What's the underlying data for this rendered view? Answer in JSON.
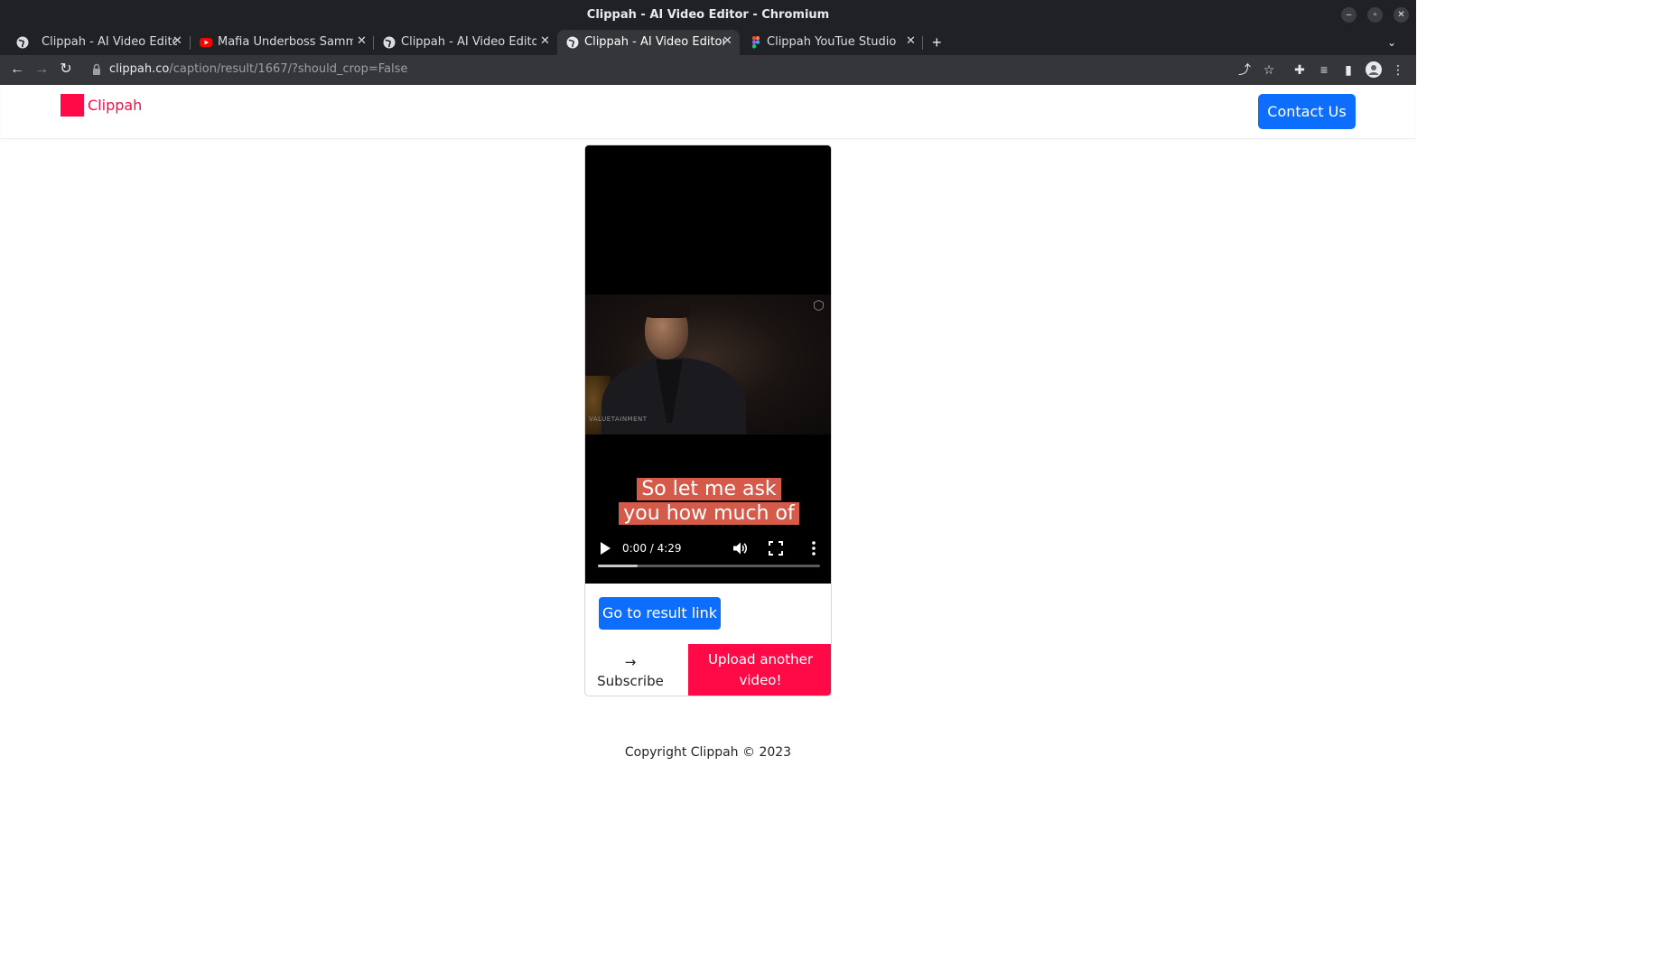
{
  "window": {
    "title": "Clippah - AI Video Editor - Chromium"
  },
  "tabs": [
    {
      "label": "Clippah - AI Video Editor",
      "favicon": "globe-icon"
    },
    {
      "label": "Mafia Underboss Sammy",
      "favicon": "youtube-icon"
    },
    {
      "label": "Clippah - AI Video Editor",
      "favicon": "globe-icon"
    },
    {
      "label": "Clippah - AI Video Editor",
      "favicon": "globe-icon",
      "active": true
    },
    {
      "label": "Clippah YouTue Studio W",
      "favicon": "figma-icon"
    }
  ],
  "address_bar": {
    "host": "clippah.co",
    "path": "/caption/result/1667/?should_crop=False"
  },
  "site": {
    "logo_text": "Clippah",
    "contact_label": "Contact Us",
    "brand_color": "#ff0a47",
    "primary_color": "#0d6efd"
  },
  "video": {
    "caption_line1": "So let me ask",
    "caption_line2": "you how much of",
    "watermark": "VALUETAINMENT",
    "time_display": "0:00 / 4:29",
    "buffered_fraction": 0.18
  },
  "actions": {
    "result_link_label": "Go to result link",
    "subscribe_arrow": "→",
    "subscribe_label": "Subscribe",
    "upload_line1": "Upload another",
    "upload_line2": "video!"
  },
  "footer": {
    "copyright": "Copyright Clippah © 2023"
  }
}
